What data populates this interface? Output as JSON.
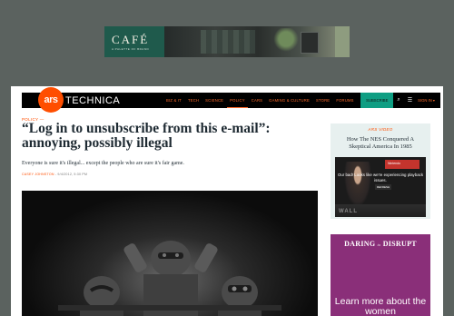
{
  "ad_banner": {
    "brand": "CAFÉ",
    "tagline": "A PALETTE OF BRAND"
  },
  "nav": {
    "logo_ars": "ars",
    "logo_word": "TECHNICA",
    "links": [
      {
        "label": "Biz & IT"
      },
      {
        "label": "Tech"
      },
      {
        "label": "Science"
      },
      {
        "label": "Policy"
      },
      {
        "label": "Cars"
      },
      {
        "label": "Gaming & Culture"
      },
      {
        "label": "Store"
      },
      {
        "label": "Forums"
      }
    ],
    "subscribe": "Subscribe",
    "search_icon": "⌕",
    "menu_icon": "☰",
    "sign_in": "Sign in ▾"
  },
  "article": {
    "category": "Policy —",
    "headline": "“Log in to unsubscribe from this e-mail”: annoying, possibly illegal",
    "dek": "Everyone is sure it's illegal... except the people who are sure it's fair game.",
    "author": "Casey Johnston",
    "date": "- 9/4/2012, 5:30 PM"
  },
  "video": {
    "label": "Ars Video",
    "title": "How The NES Conquered A Skeptical America In 1985",
    "screen_text": "Nintendo",
    "message": "Our bad! Looks like we're experiencing playback issues.",
    "refresh": "REFRESH",
    "bar_text": "WALL"
  },
  "side_ad": {
    "title_left": "DARING",
    "title_to": "to",
    "title_right": "DISRUPT",
    "body": "Learn more about the women"
  }
}
